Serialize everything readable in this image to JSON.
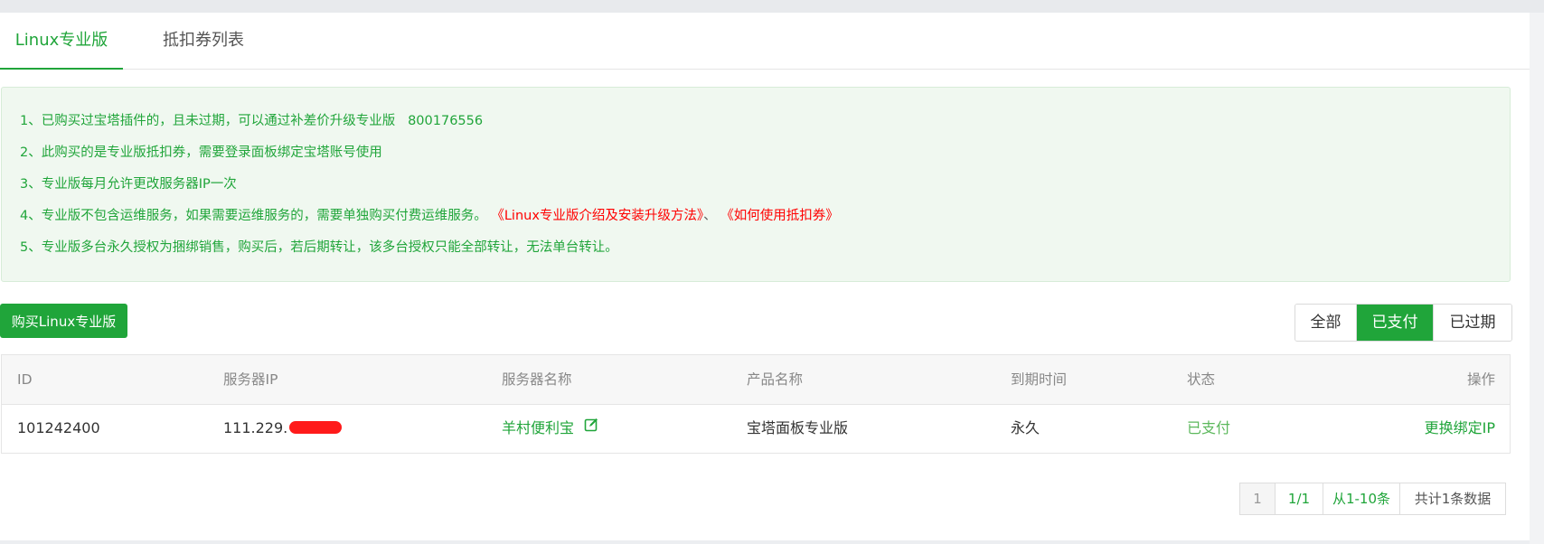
{
  "tabs": [
    {
      "label": "Linux专业版",
      "active": true
    },
    {
      "label": "抵扣券列表",
      "active": false
    }
  ],
  "notice": {
    "line1": "1、已购买过宝塔插件的，且未过期，可以通过补差价升级专业版",
    "line1_number": "800176556",
    "line2": "2、此购买的是专业版抵扣券，需要登录面板绑定宝塔账号使用",
    "line3": "3、专业版每月允许更改服务器IP一次",
    "line4": "4、专业版不包含运维服务，如果需要运维服务的，需要单独购买付费运维服务。",
    "line4_link1": "《Linux专业版介绍及安装升级方法》",
    "line4_sep": "、",
    "line4_link2": "《如何使用抵扣券》",
    "line5": "5、专业版多台永久授权为捆绑销售，购买后，若后期转让，该多台授权只能全部转让，无法单台转让。"
  },
  "buy_button": "购买Linux专业版",
  "filters": {
    "all": "全部",
    "paid": "已支付",
    "expired": "已过期",
    "active": "paid"
  },
  "table": {
    "headers": {
      "id": "ID",
      "ip": "服务器IP",
      "name": "服务器名称",
      "product": "产品名称",
      "expire": "到期时间",
      "status": "状态",
      "action": "操作"
    },
    "rows": [
      {
        "id": "101242400",
        "ip": "111.229.",
        "name": "羊村便利宝",
        "product": "宝塔面板专业版",
        "expire": "永久",
        "status": "已支付",
        "action": "更换绑定IP"
      }
    ]
  },
  "pagination": {
    "current": "1",
    "pages": "1/1",
    "range": "从1-10条",
    "total": "共计1条数据"
  },
  "colors": {
    "accent": "#20a53a",
    "link_red": "#ff0000",
    "notice_bg": "#f0f8f0",
    "redaction": "#ff1a1a"
  },
  "icons": {
    "edit": "edit-icon"
  }
}
